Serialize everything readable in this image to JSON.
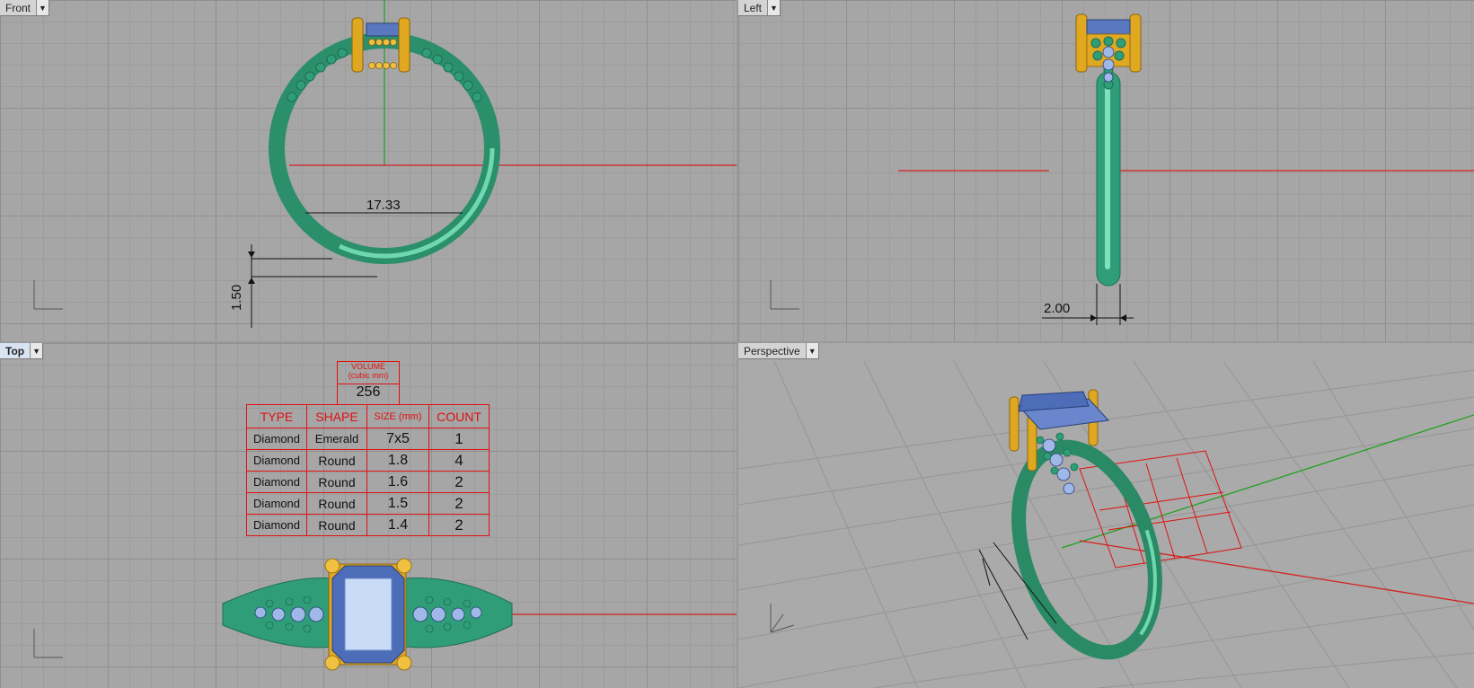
{
  "viewports": {
    "front": {
      "label": "Front",
      "dimension_width": "17.33",
      "dimension_thickness": "1.50"
    },
    "left": {
      "label": "Left",
      "dimension_width": "2.00"
    },
    "top": {
      "label": "Top"
    },
    "perspective": {
      "label": "Perspective"
    }
  },
  "volume": {
    "label": "VOLUME",
    "unit": "(cubic mm)",
    "value": "256"
  },
  "stone_table": {
    "headers": [
      "TYPE",
      "SHAPE",
      "SIZE (mm)",
      "COUNT"
    ],
    "rows": [
      [
        "Diamond",
        "Emerald",
        "7x5",
        "1"
      ],
      [
        "Diamond",
        "Round",
        "1.8",
        "4"
      ],
      [
        "Diamond",
        "Round",
        "1.6",
        "2"
      ],
      [
        "Diamond",
        "Round",
        "1.5",
        "2"
      ],
      [
        "Diamond",
        "Round",
        "1.4",
        "2"
      ]
    ]
  },
  "colors": {
    "band": "#2f9e78",
    "prong": "#e0a820",
    "stone": "#7a96d6",
    "axis_x": "#d42020",
    "axis_y": "#20a020"
  },
  "icons": {
    "viewport_menu": "dropdown-arrow-icon",
    "axes": "world-axes-icon"
  }
}
